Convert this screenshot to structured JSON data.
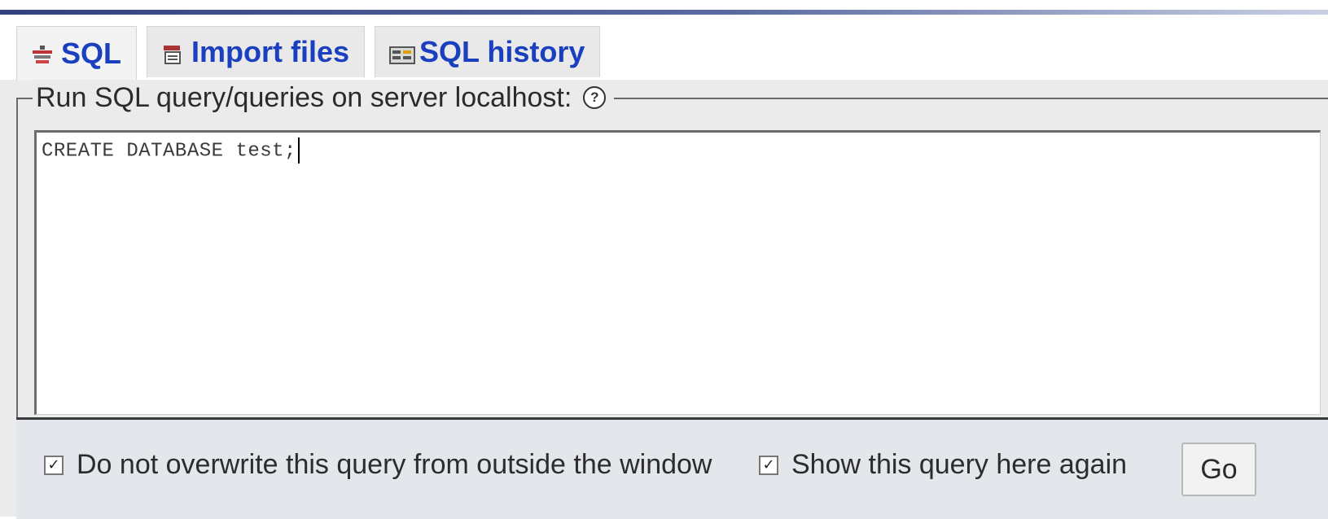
{
  "tabs": [
    {
      "label": "SQL",
      "icon": "sql-query-icon",
      "active": true
    },
    {
      "label": "Import files",
      "icon": "import-files-icon",
      "active": false
    },
    {
      "label": "SQL history",
      "icon": "sql-history-icon",
      "active": false
    }
  ],
  "fieldset": {
    "legend": "Run SQL query/queries on server localhost:",
    "help_icon": "help-icon"
  },
  "editor": {
    "value": "CREATE DATABASE test;"
  },
  "options": {
    "no_overwrite_label": "Do not overwrite this query from outside the window",
    "no_overwrite_checked": true,
    "show_again_label": "Show this query here again",
    "show_again_checked": true,
    "checkmark": "☑"
  },
  "go_label": "Go",
  "colors": {
    "tab_text": "#1a3fbf",
    "top_bar": "#32417a",
    "panel_bg": "#ebebeb"
  }
}
